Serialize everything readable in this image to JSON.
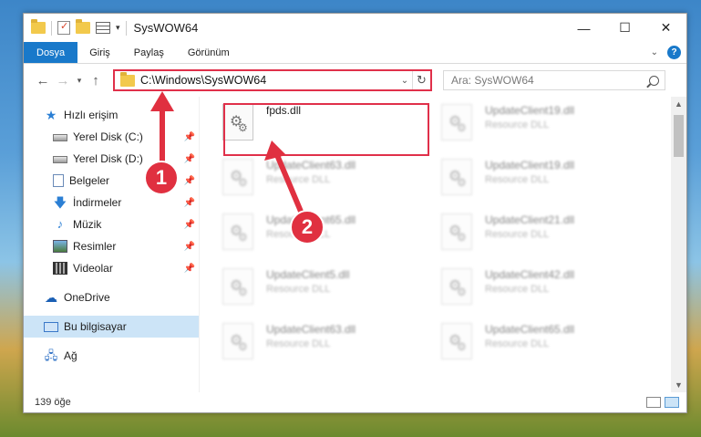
{
  "window": {
    "title": "SysWOW64",
    "controls": {
      "minimize": "—",
      "maximize": "☐",
      "close": "✕"
    }
  },
  "ribbon": {
    "tabs": [
      "Dosya",
      "Giriş",
      "Paylaş",
      "Görünüm"
    ]
  },
  "address": {
    "path": "C:\\Windows\\SysWOW64",
    "search_placeholder": "Ara: SysWOW64"
  },
  "sidebar": {
    "quick_access": "Hızlı erişim",
    "items": [
      {
        "label": "Yerel Disk (C:)",
        "icon": "disk-icon"
      },
      {
        "label": "Yerel Disk (D:)",
        "icon": "disk-icon"
      },
      {
        "label": "Belgeler",
        "icon": "documents-icon"
      },
      {
        "label": "İndirmeler",
        "icon": "downloads-icon"
      },
      {
        "label": "Müzik",
        "icon": "music-icon"
      },
      {
        "label": "Resimler",
        "icon": "pictures-icon"
      },
      {
        "label": "Videolar",
        "icon": "videos-icon"
      }
    ],
    "onedrive": "OneDrive",
    "this_pc": "Bu bilgisayar",
    "network": "Ağ"
  },
  "files": {
    "left": [
      {
        "name": "fpds.dll",
        "type": ""
      },
      {
        "name": "UpdateClient63.dll",
        "type": "Resource DLL"
      },
      {
        "name": "UpdateClient65.dll",
        "type": "Resource DLL"
      },
      {
        "name": "UpdateClient5.dll",
        "type": "Resource DLL"
      },
      {
        "name": "UpdateClient63.dll",
        "type": "Resource DLL"
      }
    ],
    "right": [
      {
        "name": "UpdateClient19.dll",
        "type": "Resource DLL"
      },
      {
        "name": "UpdateClient19.dll",
        "type": "Resource DLL"
      },
      {
        "name": "UpdateClient21.dll",
        "type": "Resource DLL"
      },
      {
        "name": "UpdateClient42.dll",
        "type": "Resource DLL"
      },
      {
        "name": "UpdateClient65.dll",
        "type": "Resource DLL"
      }
    ]
  },
  "status": {
    "count": "139 öğe"
  },
  "annotations": {
    "step1": "1",
    "step2": "2",
    "accent": "#e0304a"
  }
}
